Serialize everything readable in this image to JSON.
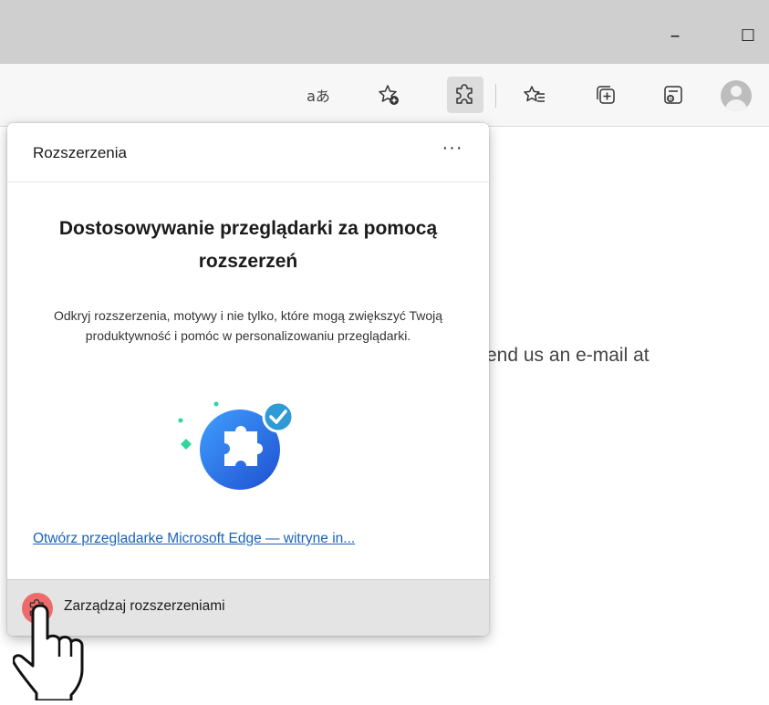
{
  "window": {
    "minimize_glyph": "–",
    "maximize_glyph": "☐"
  },
  "toolbar": {
    "read_aloud_text": "aあ",
    "icons": [
      "read-aloud-icon",
      "add-favorite-icon",
      "extensions-icon",
      "favorites-icon",
      "collections-icon",
      "web-capture-icon",
      "profile-icon"
    ]
  },
  "page": {
    "background_text": "end us an e-mail at"
  },
  "extensions_panel": {
    "title": "Rozszerzenia",
    "more_label": "···",
    "headline": "Dostosowywanie przeglądarki za pomocą rozszerzeń",
    "description": "Odkryj rozszerzenia, motywy i nie tylko, które mogą zwiększyć Twoją produktywność i pomóc w personalizowaniu przeglądarki.",
    "link_text": "Otwórz przegladarke Microsoft Edge — witryne in...",
    "footer_label": "Zarządzaj rozszerzeniami"
  },
  "colors": {
    "link": "#1a63b8",
    "illustration_blue": "#2f6fe0",
    "checkmark_blue": "#2e9bd6",
    "sparkle_green": "#2fd79a",
    "cursor_highlight": "#ec6b6b"
  }
}
